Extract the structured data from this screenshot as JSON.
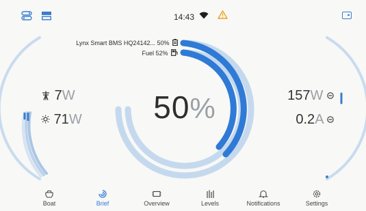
{
  "status_bar": {
    "time": "14:43",
    "left_icons": [
      "toggle-switches-icon",
      "split-view-icon"
    ],
    "right_icons": [
      "wifi-icon",
      "warning-icon",
      "wallet-card-icon"
    ]
  },
  "brief": {
    "center_value": "50",
    "center_unit": "%",
    "sources": [
      {
        "label": "Lynx Smart BMS HQ24142... 50%",
        "icon": "battery-icon",
        "fraction": 0.5
      },
      {
        "label": "Fuel 52%",
        "icon": "fuel-icon",
        "fraction": 0.52
      }
    ],
    "left": {
      "solar": {
        "value": "7",
        "unit": "W",
        "icon": "solar-tower-icon"
      },
      "sun": {
        "value": "71",
        "unit": "W",
        "icon": "sun-icon"
      }
    },
    "right": {
      "power": {
        "value": "157",
        "unit": "W",
        "icon": "minus-circle-icon"
      },
      "current": {
        "value": "0.2",
        "unit": "A",
        "icon": "minus-circle-icon"
      }
    }
  },
  "nav": {
    "items": [
      {
        "label": "Boat",
        "icon": "boat-icon",
        "active": false
      },
      {
        "label": "Brief",
        "icon": "brief-icon",
        "active": true
      },
      {
        "label": "Overview",
        "icon": "overview-icon",
        "active": false
      },
      {
        "label": "Levels",
        "icon": "levels-icon",
        "active": false
      },
      {
        "label": "Notifications",
        "icon": "bell-icon",
        "active": false
      },
      {
        "label": "Settings",
        "icon": "gear-icon",
        "active": false
      }
    ]
  },
  "colors": {
    "accent": "#2f7ad6",
    "track": "#c5d9ee",
    "background": "#f8f8f6"
  }
}
